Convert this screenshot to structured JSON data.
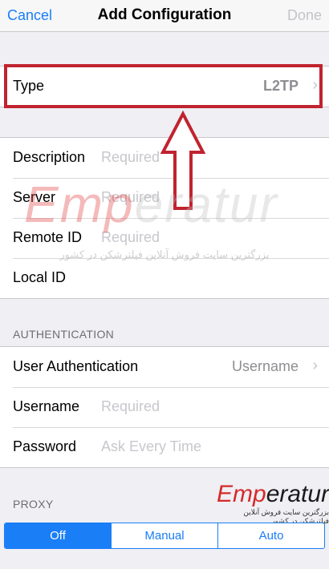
{
  "navbar": {
    "cancel_label": "Cancel",
    "title": "Add Configuration",
    "done_label": "Done"
  },
  "type_row": {
    "label": "Type",
    "value": "L2TP"
  },
  "server_group": {
    "description": {
      "label": "Description",
      "placeholder": "Required"
    },
    "server": {
      "label": "Server",
      "placeholder": "Required"
    },
    "remote_id": {
      "label": "Remote ID",
      "placeholder": "Required"
    },
    "local_id": {
      "label": "Local ID",
      "placeholder": ""
    }
  },
  "authentication": {
    "header": "AUTHENTICATION",
    "user_auth": {
      "label": "User Authentication",
      "value": "Username"
    },
    "username": {
      "label": "Username",
      "placeholder": "Required"
    },
    "password": {
      "label": "Password",
      "placeholder": "Ask Every Time"
    }
  },
  "proxy": {
    "header": "PROXY",
    "options": [
      "Off",
      "Manual",
      "Auto"
    ],
    "selected": "Off"
  },
  "watermark": {
    "brand_red": "Emp",
    "brand_rest": "eratur",
    "tagline": "بزرگترین سایت فروش آنلاین فیلترشکن در کشور"
  },
  "colors": {
    "accent": "#1a7ef7",
    "highlight": "#c0232f",
    "brand_red": "#d52a2a"
  },
  "icons": [
    "chevron-right-icon",
    "up-arrow-annotation-icon"
  ]
}
